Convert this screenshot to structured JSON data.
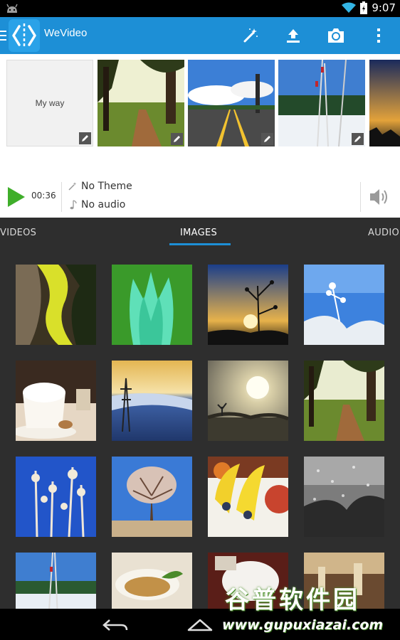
{
  "status_bar": {
    "time": "9:07"
  },
  "app": {
    "title": "WeVideo"
  },
  "action_bar": {
    "icons": [
      "magic-wand-icon",
      "upload-icon",
      "camera-icon",
      "overflow-menu-icon"
    ]
  },
  "timeline": {
    "first_clip_label": "My way",
    "duration": "00:36",
    "theme_label": "No Theme",
    "audio_label": "No audio"
  },
  "tabs": {
    "videos": "VIDEOS",
    "images": "IMAGES",
    "audio": "AUDIO",
    "active": "IMAGES"
  },
  "colors": {
    "accent": "#1d8fd6",
    "play": "#3fae2a",
    "gallery_bg": "#2e2e2e"
  },
  "watermark": {
    "cn": "谷普软件园",
    "url": "www.gupuxiazai.com"
  }
}
